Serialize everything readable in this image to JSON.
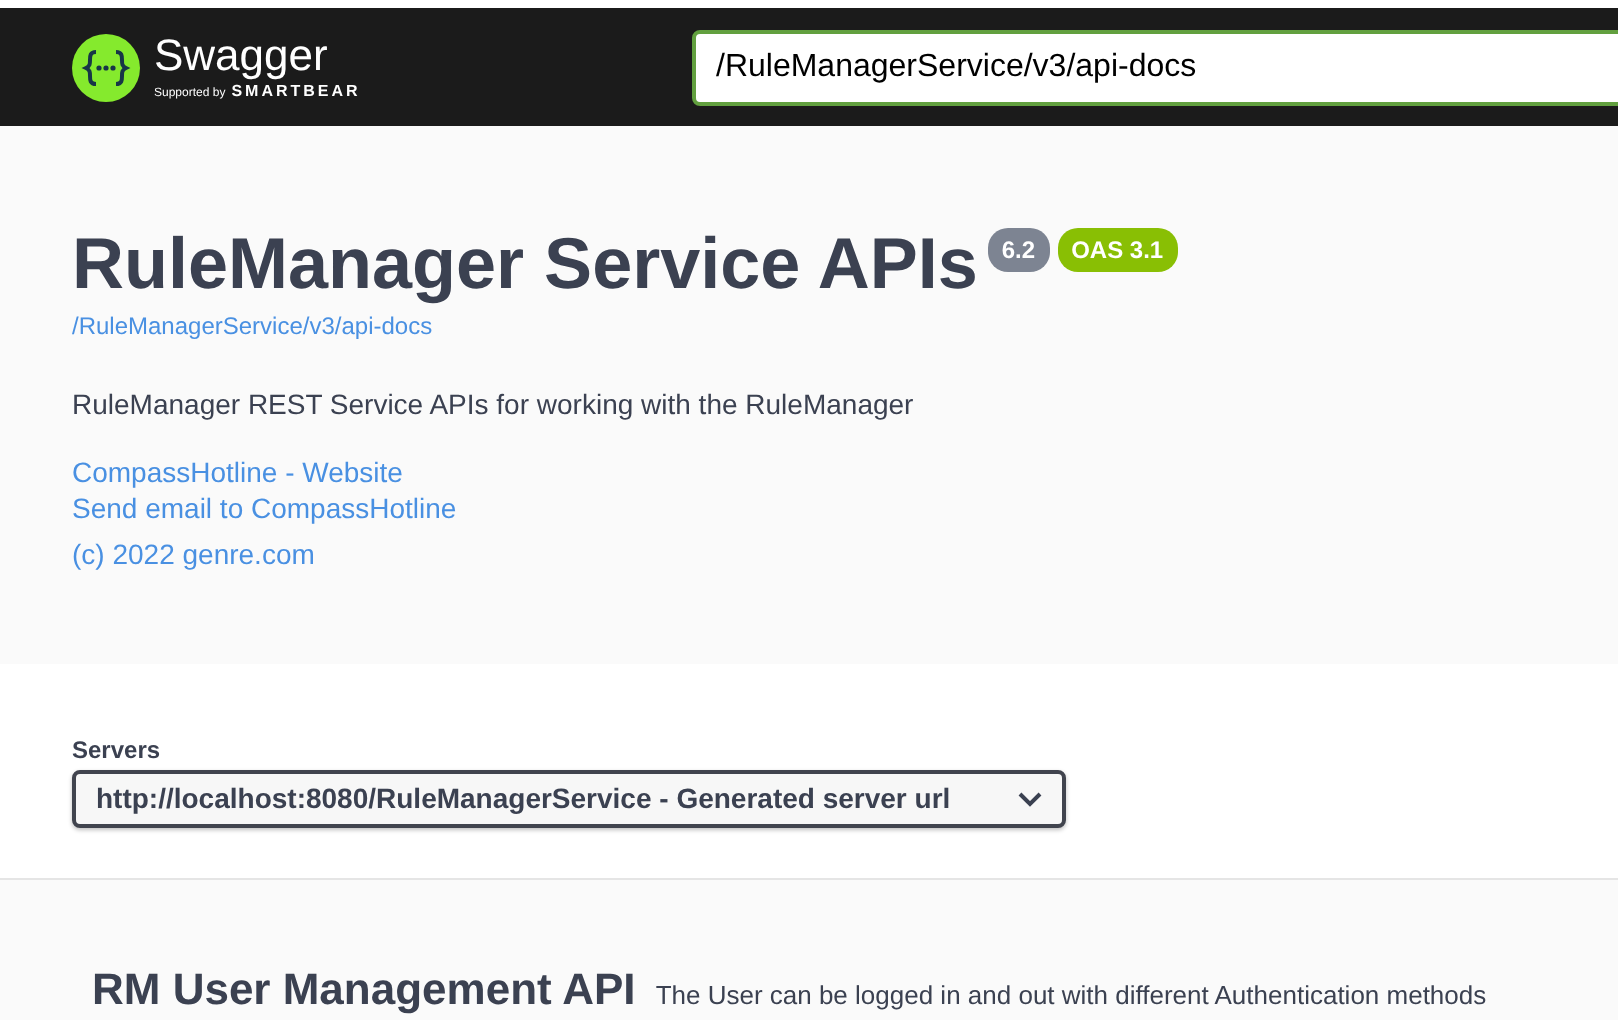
{
  "topbar": {
    "logo_name": "Swagger",
    "logo_tagline": "Supported by",
    "logo_brand": "SMARTBEAR",
    "url_field": {
      "value": "/RuleManagerService/v3/api-docs"
    }
  },
  "info": {
    "title": "RuleManager Service APIs",
    "version": "6.2",
    "oas": "OAS 3.1",
    "docs_link": "/RuleManagerService/v3/api-docs",
    "description": "RuleManager REST Service APIs for working with the RuleManager",
    "links": [
      "CompassHotline - Website",
      "Send email to CompassHotline"
    ],
    "license": "(c) 2022 genre.com"
  },
  "servers": {
    "label": "Servers",
    "selected_server": "http://localhost:8080/RuleManagerService - Generated server url"
  },
  "tags": [
    {
      "name": "RM User Management API",
      "description": "The User can be logged in and out with different Authentication methods"
    }
  ]
}
